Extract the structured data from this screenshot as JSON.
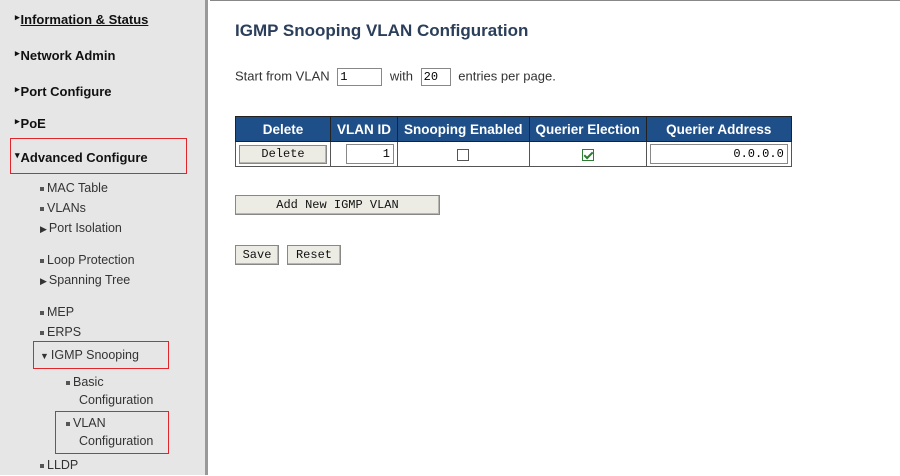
{
  "sidebar": {
    "top_items": [
      {
        "label": "Information & Status"
      },
      {
        "label": "Network Admin"
      },
      {
        "label": "Port Configure"
      },
      {
        "label": "PoE"
      },
      {
        "label": "Advanced Configure"
      }
    ],
    "advanced_items": {
      "mac_table": "MAC Table",
      "vlans": "VLANs",
      "port_isolation": "Port Isolation",
      "loop_protection": "Loop Protection",
      "spanning_tree": "Spanning Tree",
      "mep": "MEP",
      "erps": "ERPS",
      "igmp_snooping": "IGMP Snooping",
      "lldp": "LLDP"
    },
    "igmp_items": {
      "basic_line1": "Basic",
      "basic_line2": "Configuration",
      "vlan_line1": "VLAN",
      "vlan_line2": "Configuration"
    }
  },
  "main": {
    "title": "IGMP Snooping VLAN Configuration",
    "paging": {
      "prefix": "Start from VLAN",
      "start_vlan": "1",
      "middle": "with",
      "entries": "20",
      "suffix": "entries per page."
    },
    "table": {
      "headers": [
        "Delete",
        "VLAN ID",
        "Snooping Enabled",
        "Querier Election",
        "Querier Address"
      ],
      "rows": [
        {
          "delete_label": "Delete",
          "vlan_id": "1",
          "snooping_enabled": false,
          "querier_election": true,
          "querier_address": "0.0.0.0"
        }
      ]
    },
    "add_button": "Add New IGMP VLAN",
    "save_button": "Save",
    "reset_button": "Reset"
  },
  "colors": {
    "header_bg": "#1f4f88",
    "title": "#2b3e5a",
    "highlight_box": "#e0262b",
    "sidebar_bg": "#e6e6e6"
  }
}
